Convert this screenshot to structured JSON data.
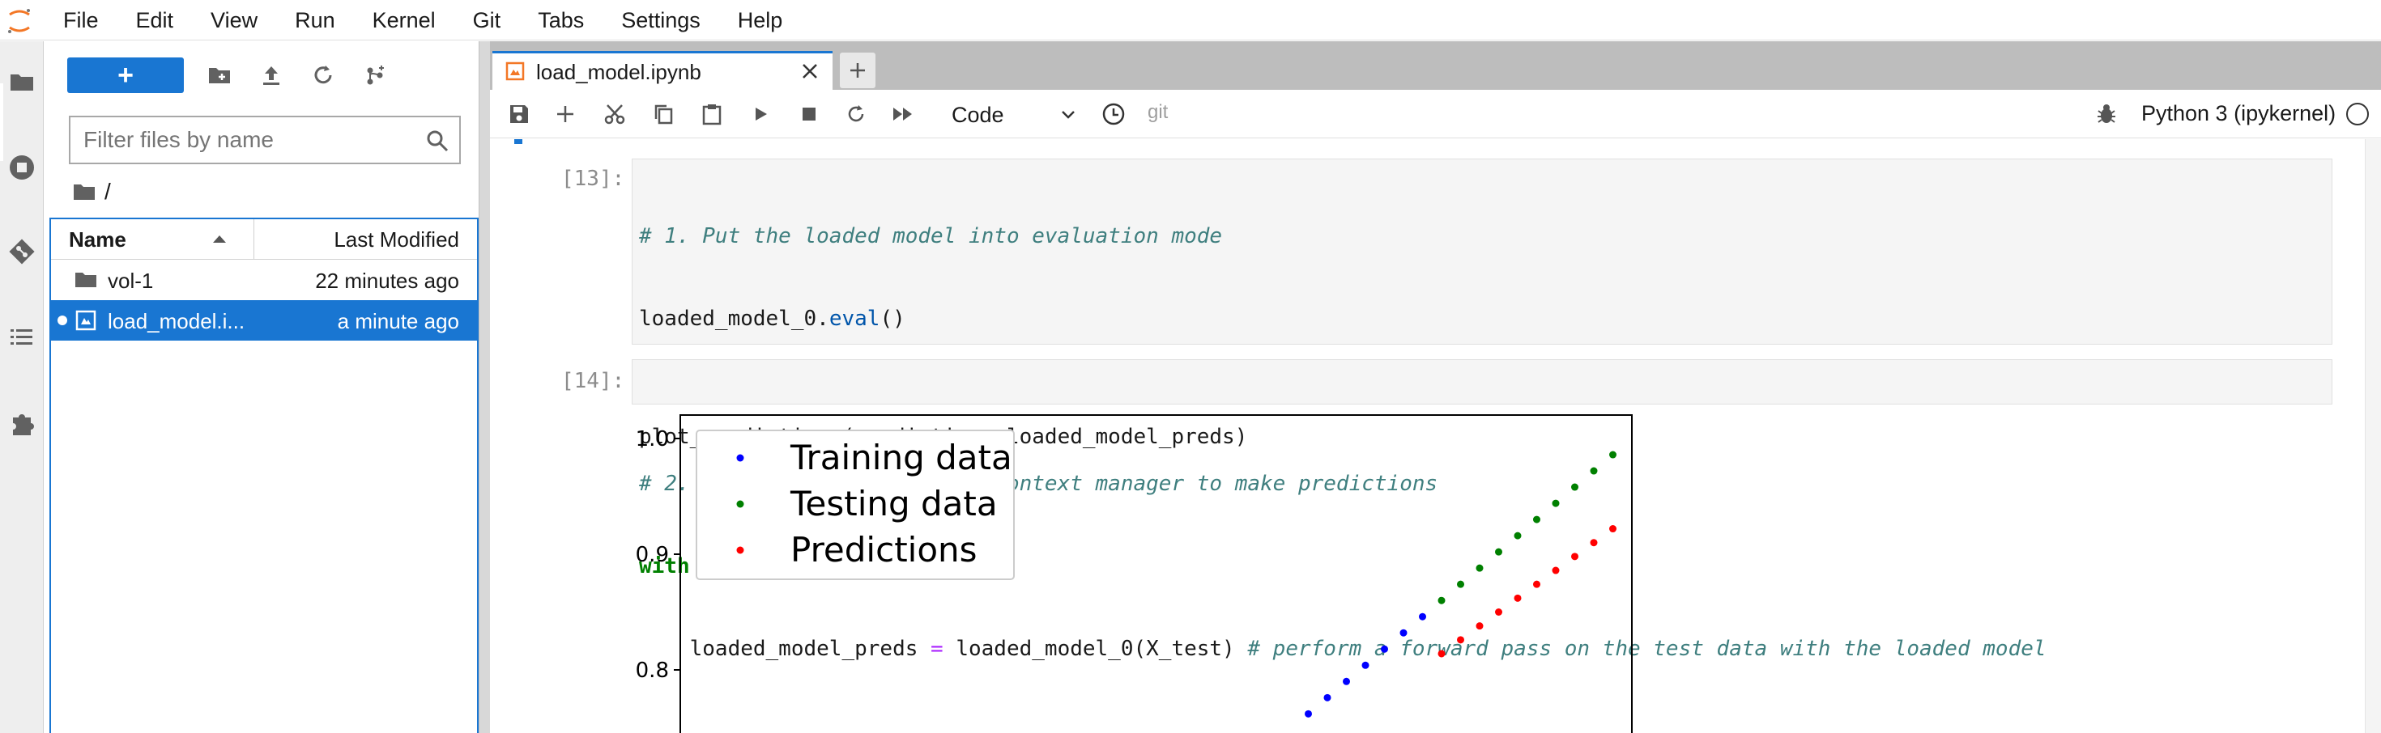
{
  "menu": {
    "items": [
      "File",
      "Edit",
      "View",
      "Run",
      "Kernel",
      "Git",
      "Tabs",
      "Settings",
      "Help"
    ]
  },
  "left_rail": {
    "icons": [
      "folder-icon",
      "running-icon",
      "git-icon",
      "toc-icon",
      "extension-icon"
    ]
  },
  "file_browser": {
    "new_button_label": "+",
    "filter_placeholder": "Filter files by name",
    "breadcrumb": "/",
    "columns": {
      "name": "Name",
      "modified": "Last Modified"
    },
    "rows": [
      {
        "name": "vol-1",
        "modified": "22 minutes ago",
        "type": "folder",
        "selected": false
      },
      {
        "name": "load_model.i...",
        "modified": "a minute ago",
        "type": "notebook",
        "selected": true
      }
    ]
  },
  "tabs": {
    "active_label": "load_model.ipynb"
  },
  "toolbar": {
    "cell_type": "Code",
    "git_label": "git",
    "kernel_name": "Python 3 (ipykernel)"
  },
  "cells": [
    {
      "prompt": "[13]:",
      "lines": [
        "# 1. Put the loaded model into evaluation mode",
        "loaded_model_0.eval()",
        "",
        "# 2. Use the inference mode context manager to make predictions",
        "with torch.no_grad():",
        "    loaded_model_preds = loaded_model_0(X_test) # perform a forward pass on the test data with the loaded model"
      ]
    },
    {
      "prompt": "[14]:",
      "lines": [
        "plot_predictions(predictions=loaded_model_preds)"
      ]
    }
  ],
  "chart_data": {
    "type": "scatter",
    "ylim": [
      0.7,
      1.0
    ],
    "xlim": [
      0.0,
      1.0
    ],
    "yticks": [
      "1.0",
      "0.9",
      "0.8"
    ],
    "legend_position": "upper-left",
    "series": [
      {
        "name": "Training data",
        "color": "#0000ff",
        "x": [
          0.66,
          0.68,
          0.7,
          0.72,
          0.74,
          0.76,
          0.78
        ],
        "y": [
          0.762,
          0.776,
          0.79,
          0.804,
          0.818,
          0.832,
          0.846
        ]
      },
      {
        "name": "Testing data",
        "color": "#008000",
        "x": [
          0.8,
          0.82,
          0.84,
          0.86,
          0.88,
          0.9,
          0.92,
          0.94,
          0.96,
          0.98
        ],
        "y": [
          0.86,
          0.874,
          0.888,
          0.902,
          0.916,
          0.93,
          0.944,
          0.958,
          0.972,
          0.986
        ]
      },
      {
        "name": "Predictions",
        "color": "#ff0000",
        "x": [
          0.8,
          0.82,
          0.84,
          0.86,
          0.88,
          0.9,
          0.92,
          0.94,
          0.96,
          0.98
        ],
        "y": [
          0.814,
          0.826,
          0.838,
          0.85,
          0.862,
          0.874,
          0.886,
          0.898,
          0.91,
          0.922
        ]
      }
    ]
  }
}
